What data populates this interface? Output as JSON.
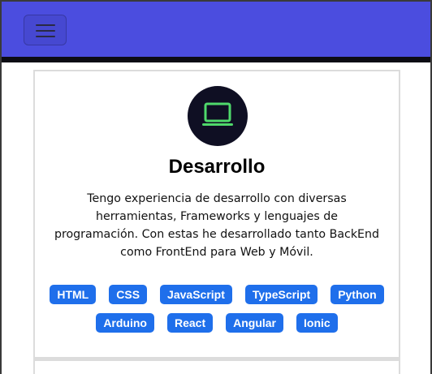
{
  "navbar": {
    "color": "#4b4ddf",
    "menu_icon": "hamburger-menu-icon"
  },
  "card": {
    "icon": "laptop-icon",
    "icon_color": "#4fd96b",
    "title": "Desarrollo",
    "description": "Tengo experiencia de desarrollo con diversas herramientas, Frameworks y lenguajes de programación. Con estas he desarrollado tanto BackEnd como FrontEnd para Web y Móvil.",
    "tags": [
      "HTML",
      "CSS",
      "JavaScript",
      "TypeScript",
      "Python",
      "Arduino",
      "React",
      "Angular",
      "Ionic"
    ],
    "tag_color": "#1f6feb"
  }
}
